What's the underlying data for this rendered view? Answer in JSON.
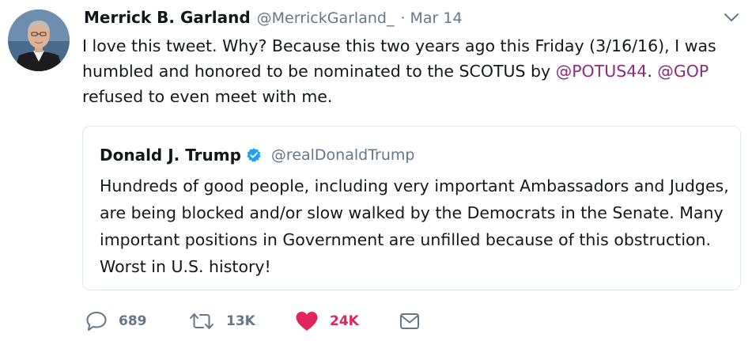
{
  "author": {
    "name": "Merrick B. Garland",
    "handle": "@MerrickGarland_",
    "separator": "·",
    "date": "Mar 14"
  },
  "tweet": {
    "text_before": "I love this tweet. Why? Because this two years ago this Friday (3/16/16), I was humbled and honored to be nominated to the SCOTUS by ",
    "mention_1": "@POTUS44",
    "text_middle": ". ",
    "mention_2": "@GOP",
    "text_after": " refused to even meet with me."
  },
  "quoted_tweet": {
    "name": "Donald J. Trump",
    "handle": "@realDonaldTrump",
    "verified": true,
    "text": "Hundreds of good people, including very important Ambassadors and Judges, are being blocked and/or slow walked by the Democrats in the Senate. Many important positions in Government are unfilled because of this obstruction. Worst in U.S. history!"
  },
  "actions": {
    "reply": {
      "icon": "reply-icon",
      "count": "689"
    },
    "retweet": {
      "icon": "retweet-icon",
      "count": "13K"
    },
    "like": {
      "icon": "heart-icon",
      "count": "24K",
      "color": "#e0245e"
    },
    "dm": {
      "icon": "envelope-icon"
    }
  },
  "colors": {
    "mention": "#8e2a7a",
    "secondary_text": "#657786",
    "verified": "#1da1f2",
    "like": "#e0245e",
    "border": "#e1e8ed"
  }
}
